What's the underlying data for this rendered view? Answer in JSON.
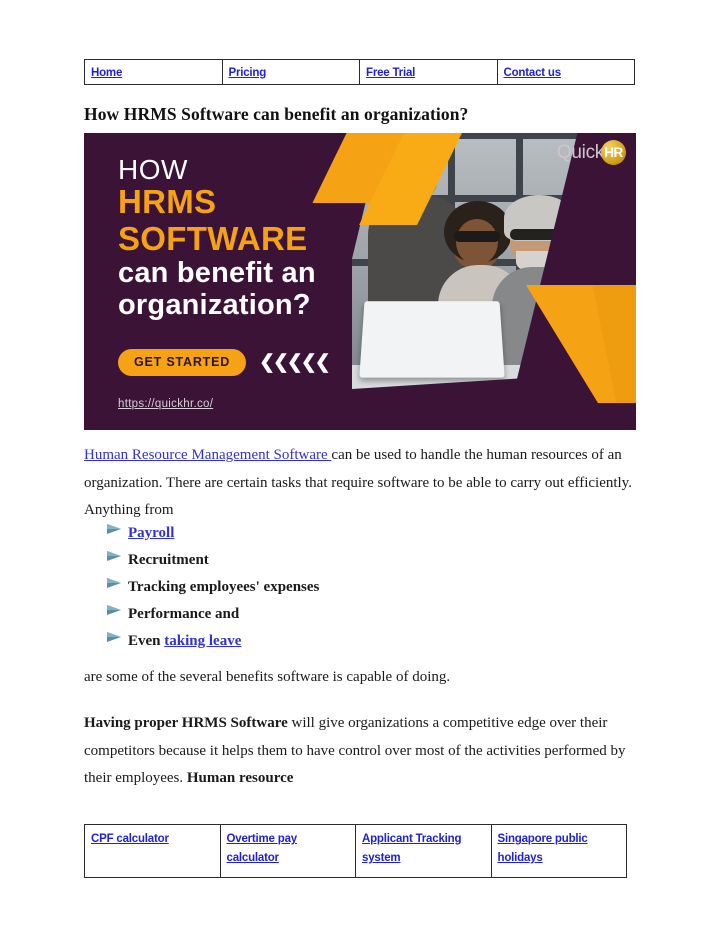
{
  "nav": {
    "items": [
      {
        "label": "Home"
      },
      {
        "label": "Pricing"
      },
      {
        "label": "Free Trial"
      },
      {
        "label": "Contact us"
      }
    ]
  },
  "article": {
    "title": "How HRMS Software can benefit an organization?"
  },
  "hero": {
    "line_how": "HOW",
    "line_hrms": "HRMS",
    "line_software": "SOFTWARE",
    "line_can_benefit": "can benefit an",
    "line_organization": "organization?",
    "cta_label": "GET STARTED",
    "chevrons": "❮❮❮❮❮",
    "url": "https://quickhr.co/",
    "logo_word": "Quick",
    "logo_badge": "HR",
    "colors": {
      "purple": "#3A1336",
      "orange": "#F5A314",
      "gold": "#D4A017",
      "white": "#FFFFFF"
    }
  },
  "paragraphs": {
    "p1_link": "Human Resource Management Software ",
    "p1_rest": "can be used to handle the human resources of an organization. There are certain tasks that require software to be able to carry out efficiently. Anything from",
    "p2": "are some of the several benefits software is capable of doing.",
    "p3_bold": "Having proper HRMS Software",
    "p3_mid": " will give organizations a competitive edge over their competitors because it helps them to have control over most of the activities performed by their employees. ",
    "p3_bold2": "Human resource"
  },
  "bullets": [
    {
      "text": "Payroll",
      "link": true
    },
    {
      "text": "Recruitment",
      "link": false
    },
    {
      "text": "Tracking employees' expenses",
      "link": false
    },
    {
      "text": "Performance and",
      "link": false
    },
    {
      "prefix": "Even ",
      "text": "taking leave",
      "link": true
    }
  ],
  "footer_links": [
    {
      "label": "CPF calculator"
    },
    {
      "label": "Overtime pay  calculator"
    },
    {
      "label": "Applicant Tracking  system"
    },
    {
      "label": "Singapore public  holidays"
    }
  ]
}
